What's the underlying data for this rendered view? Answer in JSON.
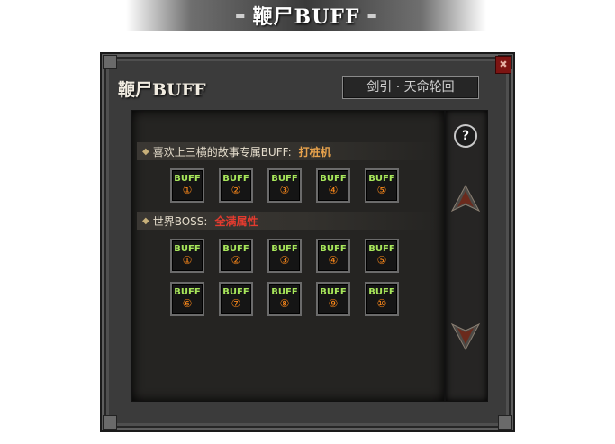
{
  "banner": {
    "dash_left": "▬",
    "title": "鞭尸BUFF",
    "dash_right": "▬"
  },
  "window": {
    "title": "鞭尸BUFF",
    "name_box": "剑引 · 天命轮回",
    "close_glyph": "✖"
  },
  "help_icon": "?",
  "sections": [
    {
      "label": "喜欢上三横的故事专属BUFF:",
      "value": "打桩机",
      "value_color": "#e7a24c",
      "rows": [
        [
          "①",
          "②",
          "③",
          "④",
          "⑤"
        ]
      ]
    },
    {
      "label": "世界BOSS:",
      "value": "全满属性",
      "value_color": "#e23b2f",
      "rows": [
        [
          "①",
          "②",
          "③",
          "④",
          "⑤"
        ],
        [
          "⑥",
          "⑦",
          "⑧",
          "⑨",
          "⑩"
        ]
      ]
    }
  ],
  "slot_label": "BUFF",
  "colors": {
    "buff_text": "#a7e65a",
    "buff_number": "#ff8a1a",
    "frame": "#3b3b3b"
  }
}
